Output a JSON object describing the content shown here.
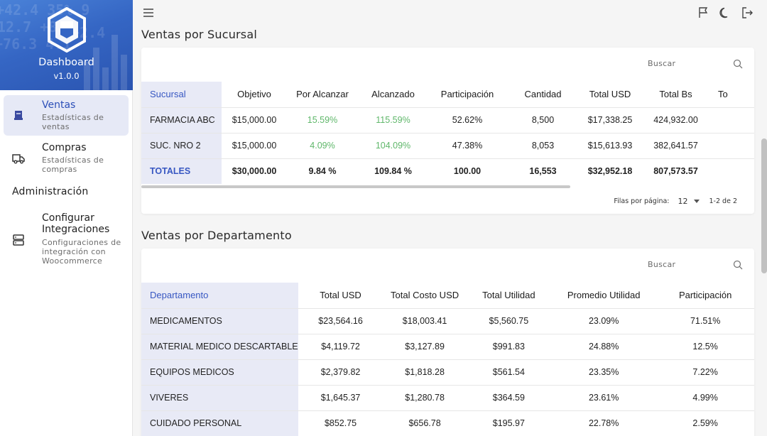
{
  "sidebar": {
    "title": "Dashboard",
    "version": "v1.0.0",
    "items": [
      {
        "label": "Ventas",
        "sub": "Estadísticas de ventas",
        "icon": "receipt-icon"
      },
      {
        "label": "Compras",
        "sub": "Estadísticas de compras",
        "icon": "truck-icon"
      }
    ],
    "section": "Administración",
    "config": {
      "label1": "Configurar",
      "label2": "Integraciones",
      "sub": "Configuraciones de integración con Woocommerce",
      "icon": "server-icon"
    }
  },
  "topbar": {
    "icons": [
      "menu-icon",
      "flag-icon",
      "moon-icon",
      "logout-icon"
    ]
  },
  "branch_sales": {
    "title": "Ventas por Sucursal",
    "search_placeholder": "Buscar",
    "columns": [
      "Sucursal",
      "Objetivo",
      "Por Alcanzar",
      "Alcanzado",
      "Participación",
      "Cantidad",
      "Total USD",
      "Total Bs",
      "To"
    ],
    "rows": [
      [
        "FARMACIA ABC",
        "$15,000.00",
        "15.59%",
        "115.59%",
        "52.62%",
        "8,500",
        "$17,338.25",
        "424,932.00",
        ""
      ],
      [
        "SUC. NRO 2",
        "$15,000.00",
        "4.09%",
        "104.09%",
        "47.38%",
        "8,053",
        "$15,613.93",
        "382,641.57",
        ""
      ],
      [
        "TOTALES",
        "$30,000.00",
        "9.84 %",
        "109.84 %",
        "100.00",
        "16,553",
        "$32,952.18",
        "807,573.57",
        ""
      ]
    ],
    "pager": {
      "label": "Filas por página:",
      "rows_per_page": "12",
      "range": "1-2 de 2"
    }
  },
  "dept_sales": {
    "title": "Ventas por Departamento",
    "search_placeholder": "Buscar",
    "columns": [
      "Departamento",
      "Total USD",
      "Total Costo USD",
      "Total Utilidad",
      "Promedio Utilidad",
      "Participación"
    ],
    "rows": [
      [
        "MEDICAMENTOS",
        "$23,564.16",
        "$18,003.41",
        "$5,560.75",
        "23.09%",
        "71.51%"
      ],
      [
        "MATERIAL MEDICO DESCARTABLE",
        "$4,119.72",
        "$3,127.89",
        "$991.83",
        "24.88%",
        "12.5%"
      ],
      [
        "EQUIPOS MEDICOS",
        "$2,379.82",
        "$1,818.28",
        "$561.54",
        "23.35%",
        "7.22%"
      ],
      [
        "VIVERES",
        "$1,645.37",
        "$1,280.78",
        "$364.59",
        "23.61%",
        "4.99%"
      ],
      [
        "CUIDADO PERSONAL",
        "$852.75",
        "$656.78",
        "$195.97",
        "22.78%",
        "2.59%"
      ]
    ]
  },
  "colors": {
    "accent": "#3757c2",
    "green": "#5fb76a",
    "header_bg": "#3566c4"
  }
}
